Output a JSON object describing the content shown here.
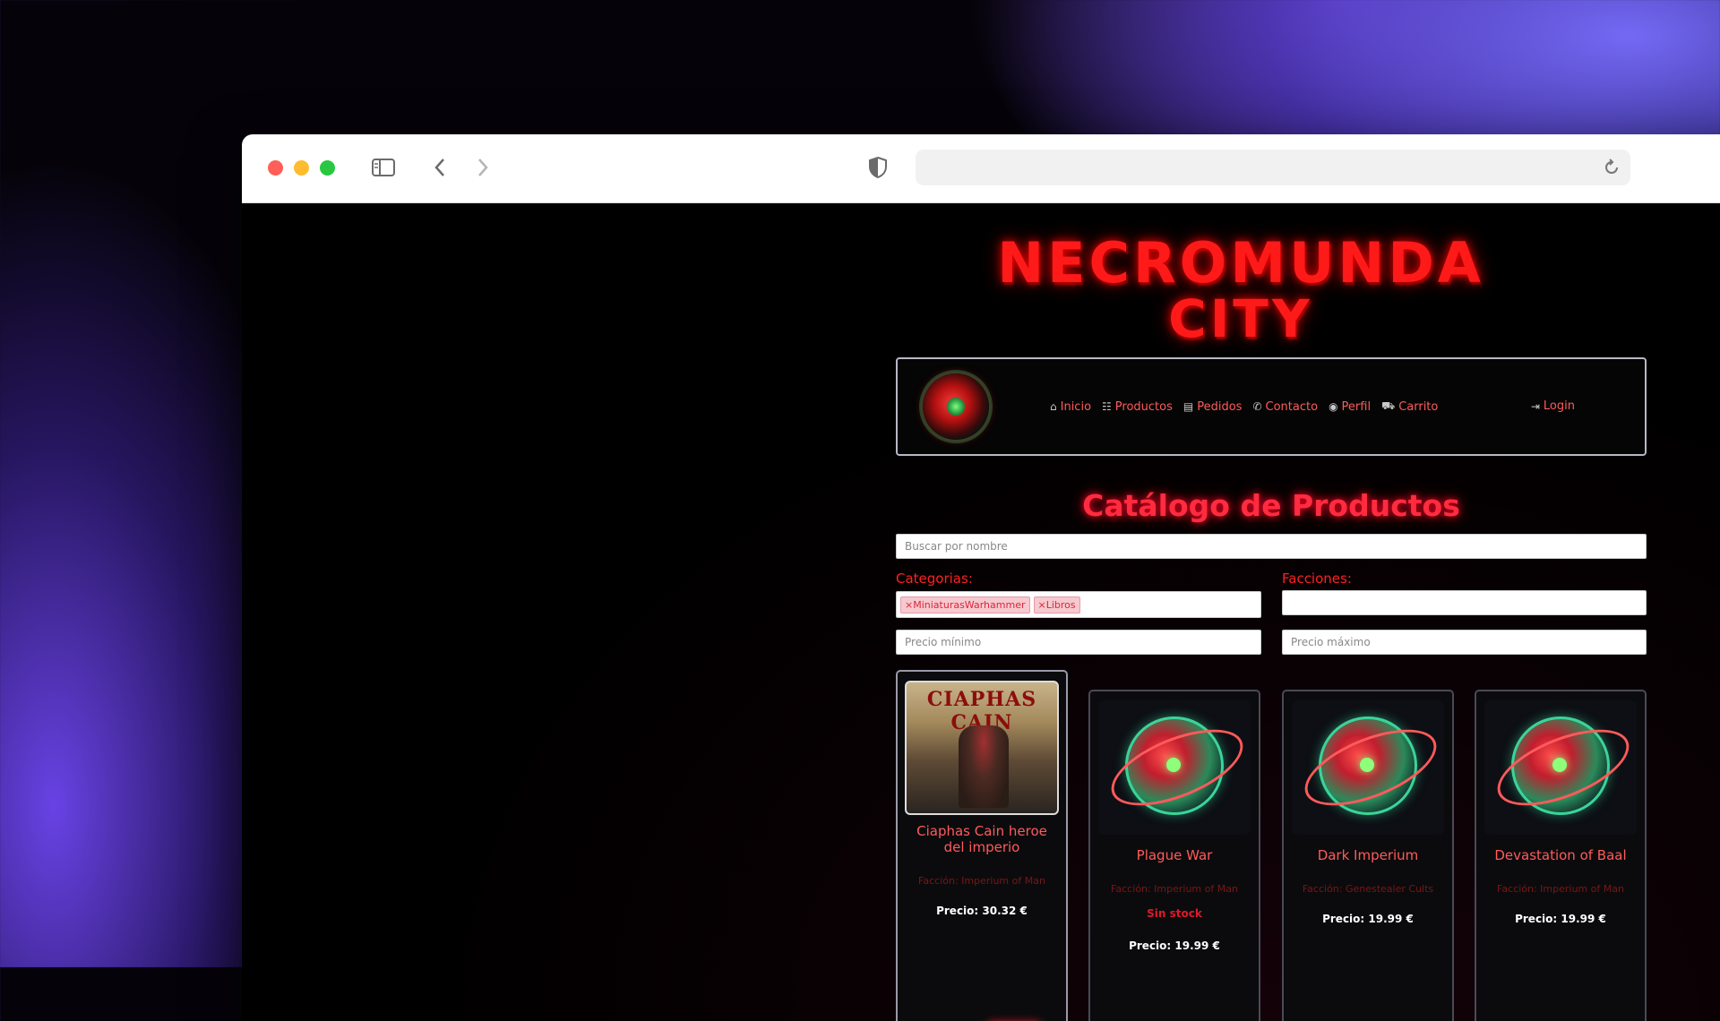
{
  "site": {
    "logo_line1": "NECROMUNDA",
    "logo_line2": "CITY"
  },
  "nav": {
    "items": [
      {
        "label": "Inicio",
        "icon": "home-icon",
        "glyph": "⌂"
      },
      {
        "label": "Productos",
        "icon": "products-icon",
        "glyph": "☷"
      },
      {
        "label": "Pedidos",
        "icon": "orders-icon",
        "glyph": "▤"
      },
      {
        "label": "Contacto",
        "icon": "phone-icon",
        "glyph": "✆"
      },
      {
        "label": "Perfil",
        "icon": "user-icon",
        "glyph": "◉"
      },
      {
        "label": "Carrito",
        "icon": "cart-icon",
        "glyph": "⛟"
      }
    ],
    "login": {
      "label": "Login",
      "icon": "login-icon",
      "glyph": "⇥"
    }
  },
  "catalog": {
    "title": "Catálogo de Productos",
    "search_placeholder": "Buscar por nombre",
    "categories_label": "Categorias:",
    "factions_label": "Facciones:",
    "category_chips": [
      "×MiniaturasWarhammer",
      "×Libros"
    ],
    "price_min_placeholder": "Precio mínimo",
    "price_max_placeholder": "Precio máximo"
  },
  "products": [
    {
      "name": "Ciaphas Cain heroe del imperio",
      "faction": "Facción: Imperium of Man",
      "stock": "",
      "price": "Precio: 30.32 €",
      "cover_text": "CIAPHAS CAIN"
    },
    {
      "name": "Plague War",
      "faction": "Facción: Imperium of Man",
      "stock": "Sin stock",
      "price": "Precio: 19.99 €"
    },
    {
      "name": "Dark Imperium",
      "faction": "Facción: Genestealer Cults",
      "stock": "",
      "price": "Precio: 19.99 €"
    },
    {
      "name": "Devastation of Baal",
      "faction": "Facción: Imperium of Man",
      "stock": "",
      "price": "Precio: 19.99 €"
    }
  ],
  "colors": {
    "accent": "#ff2020",
    "title_glow": "#ff2b3e",
    "background": "#000000"
  }
}
